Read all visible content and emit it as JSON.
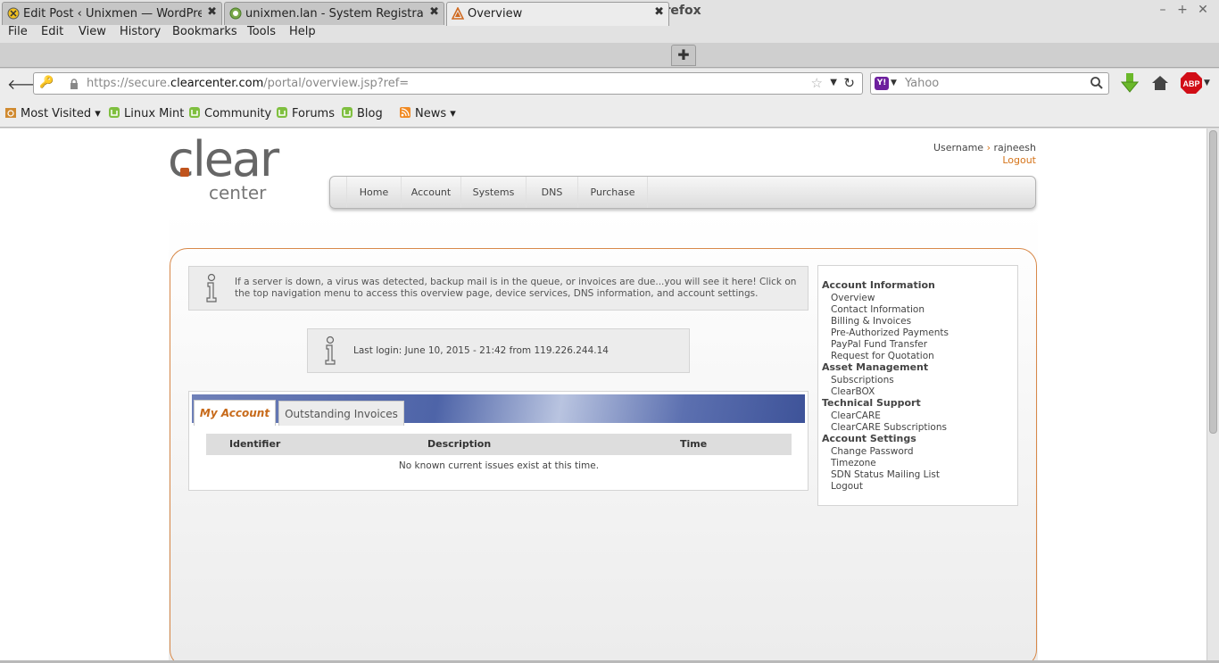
{
  "window": {
    "title": "Overview - Mozilla Firefox"
  },
  "menu": [
    "File",
    "Edit",
    "View",
    "History",
    "Bookmarks",
    "Tools",
    "Help"
  ],
  "tabs": [
    {
      "label": "Edit Post ‹ Unixmen — WordPress"
    },
    {
      "label": "unixmen.lan - System Registrat..."
    },
    {
      "label": "Overview"
    }
  ],
  "nav": {
    "url_prefix": "https://secure.",
    "url_domain": "clearcenter.com",
    "url_path": "/portal/overview.jsp?ref=",
    "search_engine": "Yahoo"
  },
  "bookmarks": [
    "Most Visited",
    "Linux Mint",
    "Community",
    "Forums",
    "Blog",
    "News"
  ],
  "site": {
    "logo_top": "clear",
    "logo_bottom": "center",
    "username_label": "Username",
    "username": "rajneesh",
    "logout": "Logout",
    "topnav": [
      "Home",
      "Account",
      "Systems",
      "DNS",
      "Purchase"
    ]
  },
  "alert": {
    "message": "If a server is down, a virus was detected, backup mail is in the queue, or invoices are due...you will see it here! Click on the top navigation menu to access this overview page, device services, DNS information, and account settings."
  },
  "login": {
    "message": "Last login: June 10, 2015 - 21:42 from 119.226.244.14"
  },
  "account_tabs": [
    "My Account",
    "Outstanding Invoices"
  ],
  "issues_table": {
    "headers": [
      "Identifier",
      "Description",
      "Time"
    ],
    "empty_message": "No known current issues exist at this time."
  },
  "sidebar": {
    "sections": [
      {
        "title": "Account Information",
        "links": [
          "Overview",
          "Contact Information",
          "Billing & Invoices",
          "Pre-Authorized Payments",
          "PayPal Fund Transfer",
          "Request for Quotation"
        ]
      },
      {
        "title": "Asset Management",
        "links": [
          "Subscriptions",
          "ClearBOX"
        ]
      },
      {
        "title": "Technical Support",
        "links": [
          "ClearCARE",
          "ClearCARE Subscriptions"
        ]
      },
      {
        "title": "Account Settings",
        "links": [
          "Change Password",
          "Timezone",
          "SDN Status Mailing List",
          "Logout"
        ]
      }
    ]
  }
}
